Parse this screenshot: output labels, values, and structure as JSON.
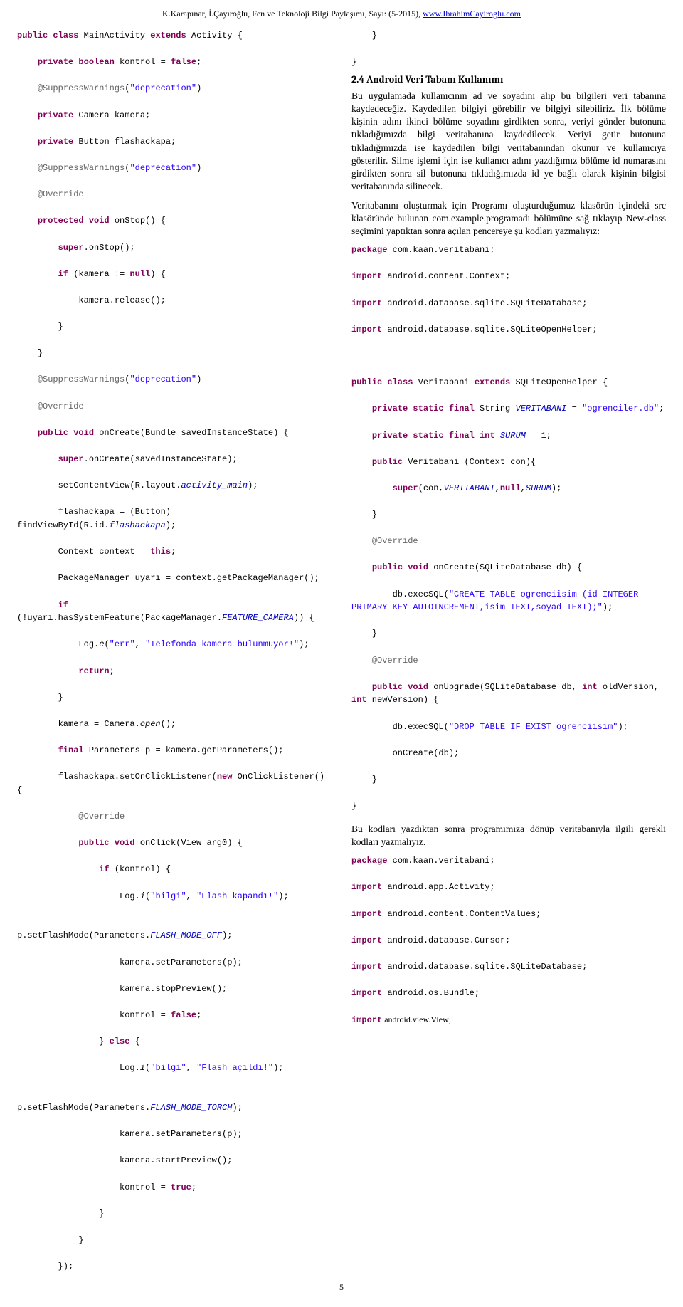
{
  "header": {
    "prefix": "K.Karapınar, İ.Çayıroğlu, Fen ve Teknoloji Bilgi Paylaşımı, Sayı: (5-2015), ",
    "link_text": "www.IbrahimCayiroglu.com"
  },
  "section": {
    "heading": "2.4 Android Veri Tabanı Kullanımı"
  },
  "paragraphs": {
    "p1": "Bu uygulamada kullanıcının ad ve soyadını alıp bu bilgileri veri tabanına kaydedeceğiz. Kaydedilen bilgiyi görebilir ve bilgiyi silebiliriz. İlk bölüme kişinin adını ikinci bölüme soyadını girdikten sonra, veriyi gönder butonuna tıkladığımızda bilgi veritabanına kaydedilecek. Veriyi getir butonuna tıkladığımızda ise kaydedilen bilgi veritabanından okunur ve kullanıcıya gösterilir. Silme işlemi için ise kullanıcı adını yazdığımız bölüme id numarasını girdikten sonra sil butonuna tıkladığımızda id ye bağlı olarak kişinin bilgisi veritabanında silinecek.",
    "p2": "Veritabanını oluşturmak için Programı oluşturduğumuz klasörün içindeki src klasöründe bulunan com.example.programadı bölümüne sağ tıklayıp New-class seçimini yaptıktan sonra açılan pencereye şu kodları yazmalıyız:",
    "p3": "Bu kodları yazdıktan sonra programımıza dönüp veritabanıyla ilgili gerekli kodları yazmalıyız."
  },
  "left_code": {
    "l01_a": "public class",
    "l01_b": " MainActivity ",
    "l01_c": "extends",
    "l01_d": " Activity {",
    "l02_a": "    private boolean",
    "l02_b": " kontrol = ",
    "l02_c": "false",
    "l02_d": ";",
    "l03_a": "    @SuppressWarnings",
    "l03_b": "(",
    "l03_c": "\"deprecation\"",
    "l03_d": ")",
    "l04_a": "    private",
    "l04_b": " Camera kamera;",
    "l05_a": "    private",
    "l05_b": " Button flashackapa;",
    "l06_a": "    @SuppressWarnings",
    "l06_b": "(",
    "l06_c": "\"deprecation\"",
    "l06_d": ")",
    "l07_a": "    @Override",
    "l08_a": "    protected void",
    "l08_b": " onStop() {",
    "l09_a": "        super",
    "l09_b": ".onStop();",
    "l10_a": "        if",
    "l10_b": " (kamera != ",
    "l10_c": "null",
    "l10_d": ") {",
    "l11": "            kamera.release();",
    "l12": "        }",
    "l13": "    }",
    "l14_a": "    @SuppressWarnings",
    "l14_b": "(",
    "l14_c": "\"deprecation\"",
    "l14_d": ")",
    "l15_a": "    @Override",
    "l16_a": "    public void",
    "l16_b": " onCreate(Bundle savedInstanceState) {",
    "l17_a": "        super",
    "l17_b": ".onCreate(savedInstanceState);",
    "l18_a": "        setContentView(R.layout.",
    "l18_b": "activity_main",
    "l18_c": ");",
    "l19_a": "        flashackapa = (Button) findViewById(R.id.",
    "l19_b": "flashackapa",
    "l19_c": ");",
    "l20_a": "        Context context = ",
    "l20_b": "this",
    "l20_c": ";",
    "l21": "        PackageManager uyarı = context.getPackageManager();",
    "l22_a": "        if",
    "l22_b": " (!uyarı.hasSystemFeature(PackageManager.",
    "l22_c": "FEATURE_CAMERA",
    "l22_d": ")) {",
    "l23_a": "            Log.",
    "l23_e": "e",
    "l23_b": "(",
    "l23_c1": "\"err\"",
    "l23_m": ", ",
    "l23_c2": "\"Telefonda kamera bulunmuyor!\"",
    "l23_d": ");",
    "l24_a": "            return",
    "l24_b": ";",
    "l25": "        }",
    "l26_a": "        kamera = Camera.",
    "l26_o": "open",
    "l26_b": "();",
    "l27_a": "        final",
    "l27_b": " Parameters p = kamera.getParameters();",
    "l28_a": "        flashackapa.setOnClickListener(",
    "l28_b": "new",
    "l28_c": " OnClickListener() {",
    "l29_a": "            @Override",
    "l30_a": "            public void",
    "l30_b": " onClick(View arg0) {",
    "l31_a": "                if",
    "l31_b": " (kontrol) {",
    "l32_a": "                    Log.",
    "l32_i": "i",
    "l32_b": "(",
    "l32_c1": "\"bilgi\"",
    "l32_m": ", ",
    "l32_c2": "\"Flash kapandı!\"",
    "l32_d": ");",
    "l33_a": "                    p.setFlashMode(Parameters.",
    "l33_b": "FLASH_MODE_OFF",
    "l33_c": ");",
    "l34": "                    kamera.setParameters(p);",
    "l35": "                    kamera.stopPreview();",
    "l36_a": "                    kontrol = ",
    "l36_b": "false",
    "l36_c": ";",
    "l37_a": "                } ",
    "l37_b": "else",
    "l37_c": " {",
    "l38_a": "                    Log.",
    "l38_i": "i",
    "l38_b": "(",
    "l38_c1": "\"bilgi\"",
    "l38_m": ", ",
    "l38_c2": "\"Flash açıldı!\"",
    "l38_d": ");",
    "l39_a": "                    p.setFlashMode(Parameters.",
    "l39_b": "FLASH_MODE_TORCH",
    "l39_c": ");",
    "l40": "                    kamera.setParameters(p);",
    "l41": "                    kamera.startPreview();",
    "l42_a": "                    kontrol = ",
    "l42_b": "true",
    "l42_c": ";",
    "l43": "                }",
    "l44": "            }",
    "l45": "        });"
  },
  "right_code_top": {
    "r01": "    }",
    "r02": "}"
  },
  "right_code_block1": {
    "b1_a": "package",
    "b1_b": " com.kaan.veritabani;",
    "b2_a": "import",
    "b2_b": " android.content.Context;",
    "b3_a": "import",
    "b3_b": " android.database.sqlite.SQLiteDatabase;",
    "b4_a": "import",
    "b4_b": " android.database.sqlite.SQLiteOpenHelper;",
    "blank": "",
    "b5_a": "public class",
    "b5_b": " Veritabani ",
    "b5_c": "extends",
    "b5_d": " SQLiteOpenHelper {",
    "b6_a": "    private static final",
    "b6_b": " String ",
    "b6_c": "VERITABANI",
    "b6_d": " = ",
    "b6_e": "\"ogrenciler.db\"",
    "b6_f": ";",
    "b7_a": "    private static final int ",
    "b7_b": "SURUM",
    "b7_c": " = 1;",
    "b8_a": "    public",
    "b8_b": " Veritabani (Context con){",
    "b9_a": "        super",
    "b9_b": "(con,",
    "b9_c": "VERITABANI",
    "b9_d": ",",
    "b9_e": "null",
    "b9_f": ",",
    "b9_g": "SURUM",
    "b9_h": ");",
    "b10": "    }",
    "b11_a": "    @Override",
    "b12_a": "    public void",
    "b12_b": " onCreate(SQLiteDatabase db) {",
    "b13_a": "        db.execSQL(",
    "b13_b": "\"CREATE TABLE ogrenciisim (id INTEGER PRIMARY KEY AUTOINCREMENT,isim TEXT,soyad TEXT);\"",
    "b13_c": ");",
    "b14": "    }",
    "b15_a": "    @Override",
    "b16_a": "    public void",
    "b16_b": " onUpgrade(SQLiteDatabase db, ",
    "b16_c": "int",
    "b16_d": " oldVersion, ",
    "b16_e": "int",
    "b16_f": " newVersion) {",
    "b17_a": "        db.execSQL(",
    "b17_b": "\"DROP TABLE IF EXIST ogrenciisim\"",
    "b17_c": ");",
    "b18": "        onCreate(db);",
    "b19": "    }",
    "b20": "}"
  },
  "right_code_block2": {
    "c1_a": "package",
    "c1_b": " com.kaan.veritabani;",
    "c2_a": "import",
    "c2_b": " android.app.Activity;",
    "c3_a": "import",
    "c3_b": " android.content.ContentValues;",
    "c4_a": "import",
    "c4_b": " android.database.Cursor;",
    "c5_a": "import",
    "c5_b": " android.database.sqlite.SQLiteDatabase;",
    "c6_a": "import",
    "c6_b": " android.os.Bundle;",
    "c7_a": "import",
    "c7_b": " android.view.View;"
  },
  "page_number": "5"
}
